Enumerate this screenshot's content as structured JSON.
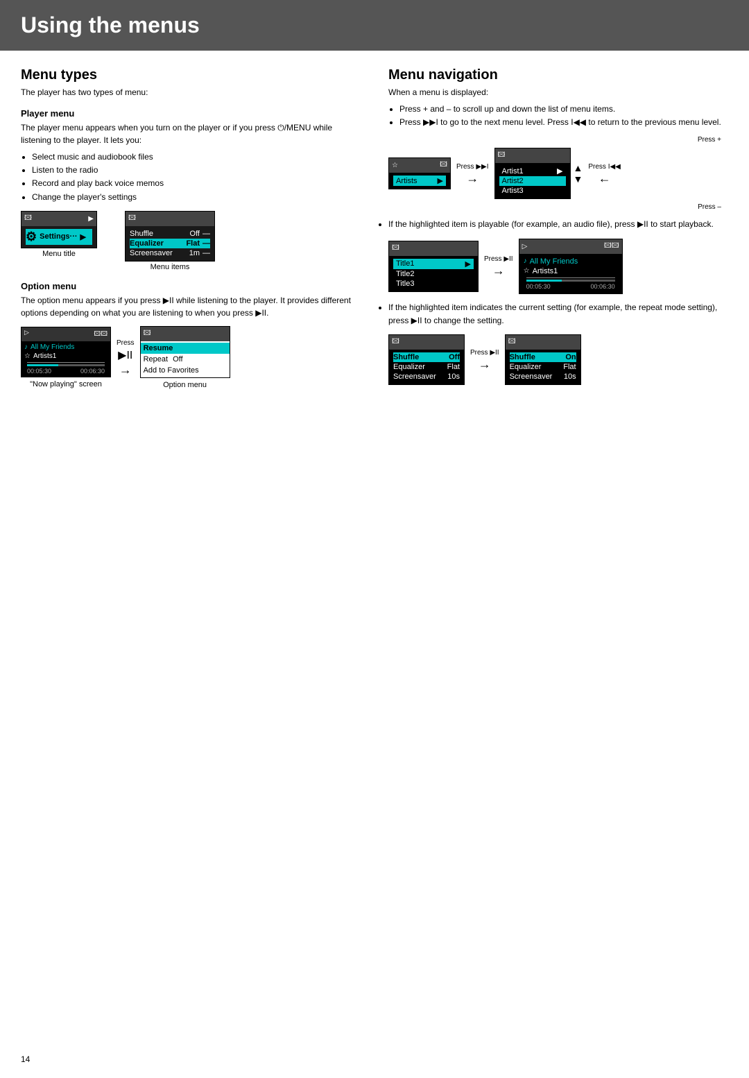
{
  "page": {
    "title": "Using the menus",
    "page_number": "14"
  },
  "left": {
    "section_title": "Menu types",
    "subtitle": "The player has two types of menu:",
    "player_menu": {
      "heading": "Player menu",
      "description": "The player menu appears when you turn on the player or if you press ⏻/MENU while listening to the player. It lets you:",
      "items": [
        "Select music and audiobook files",
        "Listen to the radio",
        "Record and play back voice memos",
        "Change the player's settings"
      ],
      "diagram_labels": {
        "menu_title": "Menu title",
        "menu_items": "Menu items"
      }
    },
    "option_menu": {
      "heading": "Option menu",
      "description1": "The option menu appears if you press ▶II while listening to the player. It provides different options depending on what you are listening to when you press ▶II.",
      "screen_label": "\"Now playing\" screen",
      "option_label": "Option menu",
      "press_label": "Press",
      "play_symbol": "▶II"
    }
  },
  "right": {
    "section_title": "Menu navigation",
    "subtitle": "When a menu is displayed:",
    "bullets": [
      "Press + and – to scroll up and down the list of menu items.",
      "Press ▶▶I to go to the next menu level. Press I◀◀ to return to the previous menu level."
    ],
    "bullet3": "If the highlighted item is playable (for example, an audio file), press ▶II to start playback.",
    "bullet4": "If the highlighted item indicates the current setting (for example, the repeat mode setting), press ▶II to change the setting."
  },
  "screens": {
    "settings_menu": {
      "rows": [
        {
          "label": "Shuffle",
          "value": "Off",
          "highlight": false
        },
        {
          "label": "Equalizer",
          "value": "Flat",
          "highlight": true
        },
        {
          "label": "Screensaver",
          "value": "1m",
          "highlight": false
        }
      ]
    },
    "player_settings": {
      "label": "Settings"
    },
    "now_playing": {
      "title1": "All My Friends",
      "title2": "Artists1",
      "time1": "00:05:30",
      "time2": "00:06:30"
    },
    "option_menu": {
      "rows": [
        {
          "label": "Resume",
          "highlight": true
        },
        {
          "label": "Repeat",
          "value": "Off",
          "highlight": false
        },
        {
          "label": "Add to Favorites",
          "highlight": false
        }
      ]
    },
    "artists": {
      "label": "Artists",
      "rows": [
        {
          "label": "Artist1",
          "highlight": false
        },
        {
          "label": "Artist2",
          "highlight": true
        },
        {
          "label": "Artist3",
          "highlight": false
        }
      ]
    },
    "playback_right": {
      "title1": "All My Friends",
      "title2": "Artists1",
      "time1": "00:05:30",
      "time2": "00:06:30"
    },
    "shuffle_before": {
      "rows": [
        {
          "label": "Shuffle",
          "value": "Off",
          "highlight": true
        },
        {
          "label": "Equalizer",
          "value": "Flat",
          "highlight": false
        },
        {
          "label": "Screensaver",
          "value": "10s",
          "highlight": false
        }
      ]
    },
    "shuffle_after": {
      "rows": [
        {
          "label": "Shuffle",
          "value": "On",
          "highlight": true
        },
        {
          "label": "Equalizer",
          "value": "Flat",
          "highlight": false
        },
        {
          "label": "Screensaver",
          "value": "10s",
          "highlight": false
        }
      ]
    }
  },
  "labels": {
    "press_ff": "Press ▶▶I",
    "press_rew": "Press I◀◀",
    "press_play": "Press ▶II",
    "press_plus": "Press +",
    "press_minus": "Press –",
    "press": "Press",
    "play_symbol": "▶II",
    "ff_symbol": "▶▶I",
    "rew_symbol": "I◀◀"
  }
}
